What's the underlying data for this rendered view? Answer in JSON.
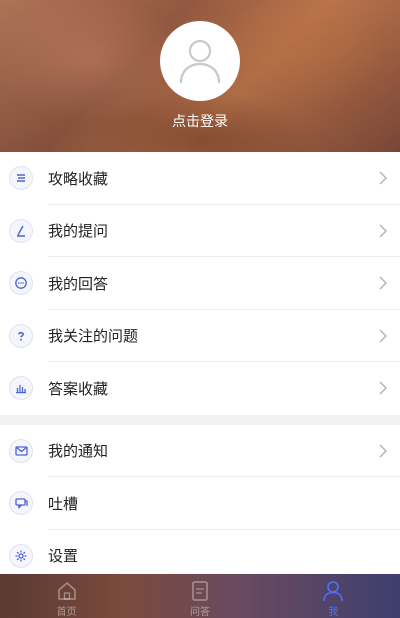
{
  "profile": {
    "login_text": "点击登录"
  },
  "menu": {
    "group1": [
      {
        "label": "攻略收藏",
        "icon": "list-icon",
        "has_arrow": true
      },
      {
        "label": "我的提问",
        "icon": "pen-icon",
        "has_arrow": true
      },
      {
        "label": "我的回答",
        "icon": "chat-bubble-icon",
        "has_arrow": true
      },
      {
        "label": "我关注的问题",
        "icon": "question-icon",
        "has_arrow": true
      },
      {
        "label": "答案收藏",
        "icon": "bar-chart-icon",
        "has_arrow": true
      }
    ],
    "group2": [
      {
        "label": "我的通知",
        "icon": "mail-icon",
        "has_arrow": true
      },
      {
        "label": "吐槽",
        "icon": "feedback-icon",
        "has_arrow": false
      },
      {
        "label": "设置",
        "icon": "gear-icon",
        "has_arrow": false
      }
    ]
  },
  "tabbar": {
    "tabs": [
      {
        "label": "首页",
        "icon": "home-icon",
        "active": false
      },
      {
        "label": "问答",
        "icon": "qa-icon",
        "active": false
      },
      {
        "label": "我",
        "icon": "person-icon",
        "active": true
      }
    ]
  },
  "colors": {
    "accent": "#4f6fff",
    "icon_blue": "#4a63d8",
    "text": "#222222",
    "chevron": "#b5b5b5"
  }
}
